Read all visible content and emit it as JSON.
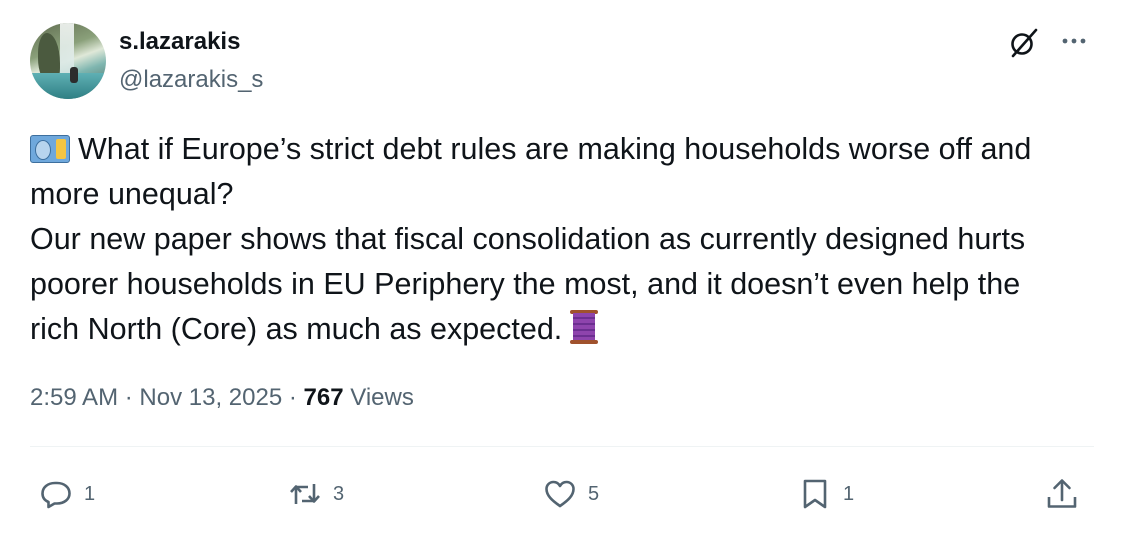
{
  "author": {
    "display_name": "s.lazarakis",
    "handle": "@lazarakis_s",
    "avatar_icon": "avatar-waterfall-photo"
  },
  "header_icons": {
    "grok": "grok-icon",
    "more": "more-icon"
  },
  "tweet": {
    "line1": "What if Europe’s strict debt rules are making households worse off and",
    "line2": "more unequal?",
    "line3": "Our new paper shows that fiscal consolidation as currently designed hurts",
    "line4": "poorer households in EU Periphery the most, and it doesn’t even help the",
    "line5": "rich North (Core) as much as expected.",
    "leading_emoji": "euro-banknote-icon",
    "trailing_emoji": "thread-spool-icon"
  },
  "meta": {
    "time": "2:59 AM",
    "separator": "·",
    "date": "Nov 13, 2025",
    "views_count": "767",
    "views_label": "Views"
  },
  "actions": {
    "replies": "1",
    "reposts": "3",
    "likes": "5",
    "bookmarks": "1"
  },
  "colors": {
    "text_primary": "#0f1419",
    "text_secondary": "#536471",
    "divider": "#eff3f4"
  }
}
